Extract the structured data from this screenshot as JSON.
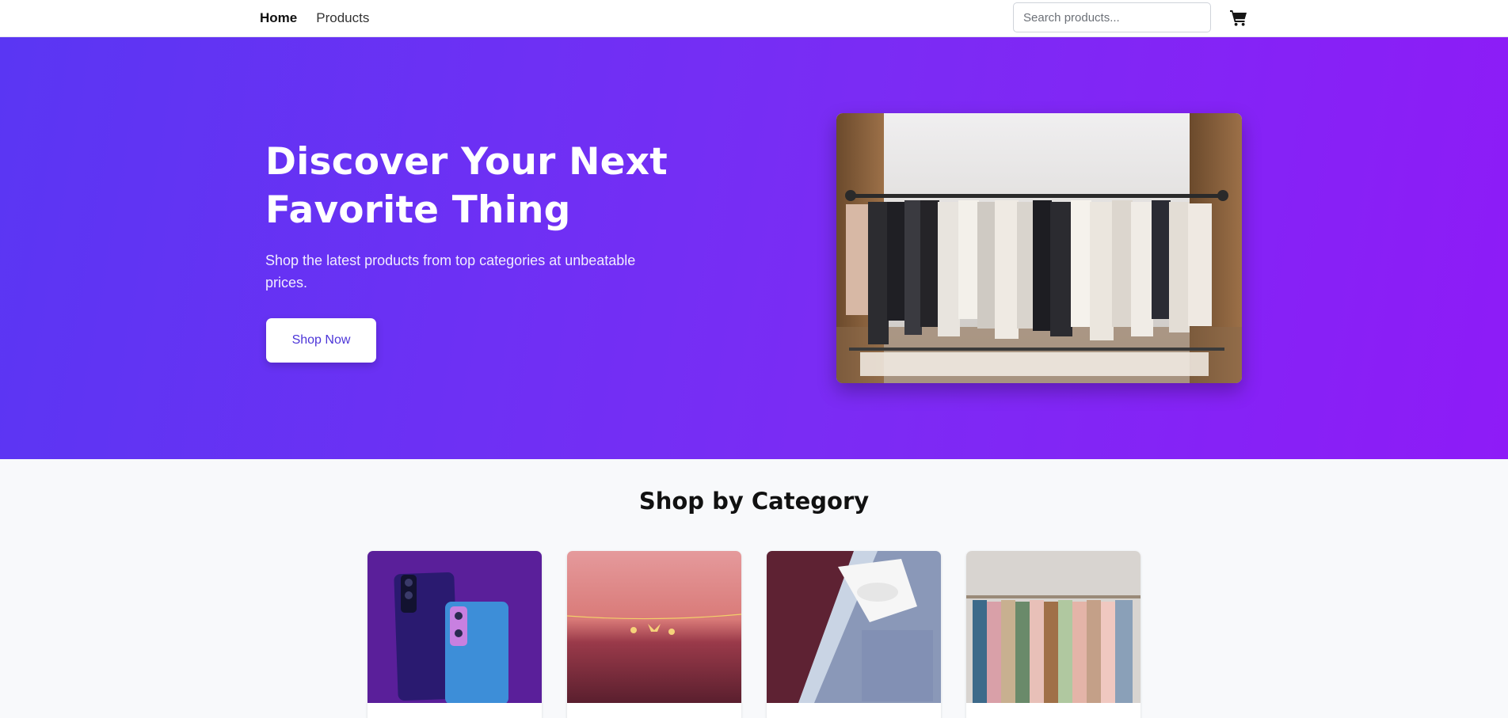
{
  "nav": {
    "home_label": "Home",
    "products_label": "Products",
    "search_placeholder": "Search products...",
    "cart_icon": "shopping-cart-icon"
  },
  "hero": {
    "title": "Discover Your Next Favorite Thing",
    "subtitle": "Shop the latest products from top categories at unbeatable prices.",
    "cta_label": "Shop Now",
    "image": "clothing-rack-photo"
  },
  "categories": {
    "title": "Shop by Category",
    "items": [
      {
        "image": "smartphones-photo"
      },
      {
        "image": "jewelry-necklace-photo"
      },
      {
        "image": "mens-shirts-photo"
      },
      {
        "image": "womens-clothing-rack-photo"
      }
    ]
  },
  "colors": {
    "hero_gradient_start": "#5a36f3",
    "hero_gradient_end": "#8e1bf7",
    "button_text": "#4c35d8",
    "page_background": "#f8f9fb"
  }
}
